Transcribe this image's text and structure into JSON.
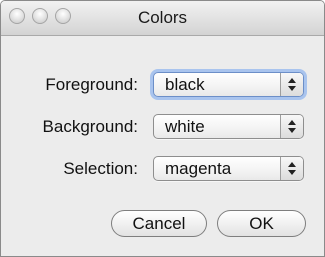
{
  "window": {
    "title": "Colors"
  },
  "form": {
    "rows": [
      {
        "label": "Foreground:",
        "value": "black"
      },
      {
        "label": "Background:",
        "value": "white"
      },
      {
        "label": "Selection:",
        "value": "magenta"
      }
    ]
  },
  "buttons": {
    "cancel_label": "Cancel",
    "ok_label": "OK"
  },
  "icons": {
    "close": "close-icon",
    "minimize": "minimize-icon",
    "zoom": "zoom-icon",
    "popup_arrows": "up-down-arrows-icon"
  }
}
